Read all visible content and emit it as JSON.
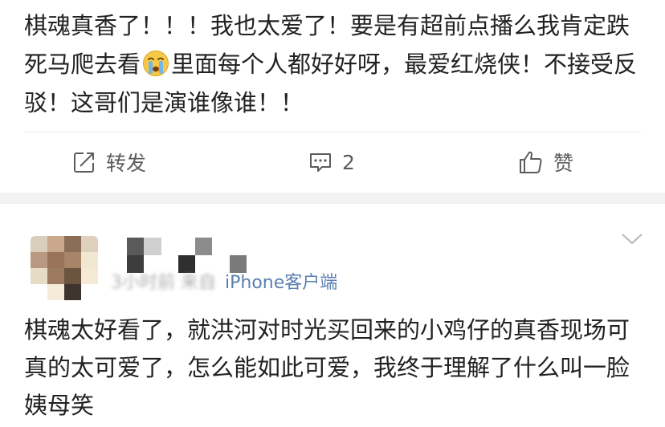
{
  "post1": {
    "text_before_emoji": "棋魂真香了！！！我也太爱了！要是有超前点播么我肯定跌死马爬去看",
    "emoji_name": "crying-face-icon",
    "text_after_emoji": "里面每个人都好好呀，最爱红烧侠！不接受反驳！这哥们是演谁像谁！！",
    "actions": {
      "repost_label": "转发",
      "comment_count": "2",
      "like_label": "赞"
    }
  },
  "post2": {
    "time_blurred": "3小时前",
    "from_blurred": "来自",
    "source": "iPhone客户端",
    "text": "棋魂太好看了，就洪河对时光买回来的小鸡仔的真香现场可真的太可爱了，怎么能如此可爱，我终于理解了什么叫一脸姨母笑"
  },
  "colors": {
    "text": "#222222",
    "muted": "#5c5c5c",
    "meta": "#9a9a9a",
    "link": "#5a7fb0",
    "separator": "#f2f2f2"
  }
}
